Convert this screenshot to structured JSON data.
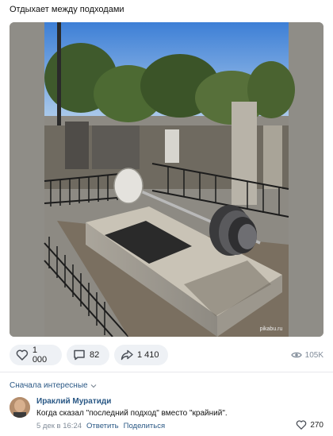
{
  "post": {
    "text": "Отдыхает между подходами",
    "watermark": "pikabu.ru"
  },
  "actions": {
    "likes": "1 000",
    "comments": "82",
    "shares": "1 410",
    "views": "105K"
  },
  "comments_header": {
    "sort_label": "Сначала интересные"
  },
  "comment": {
    "author": "Ираклий Муратиди",
    "text": "Когда сказал \"последний подход\" вместо \"крайний\".",
    "date": "5 дек в 16:24",
    "reply_label": "Ответить",
    "share_label": "Поделиться",
    "likes": "270"
  },
  "icons": {
    "like": "heart-icon",
    "comment": "comment-icon",
    "share": "share-arrow-icon",
    "views": "eye-icon",
    "sort": "chevron-down-icon"
  },
  "colors": {
    "link": "#2a5885",
    "muted": "#818c99",
    "pill_bg": "#eef1f5"
  }
}
